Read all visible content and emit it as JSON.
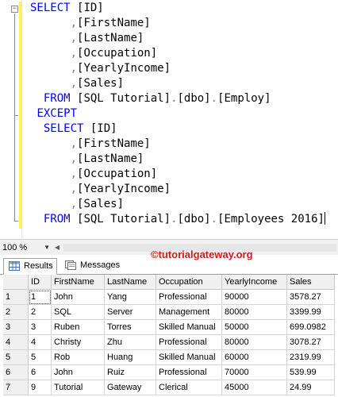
{
  "editor": {
    "lines": [
      {
        "indent": "",
        "segments": [
          {
            "c": "kw",
            "t": "SELECT"
          },
          {
            "c": "pun",
            "t": " "
          },
          {
            "c": "ident",
            "t": "[ID]"
          }
        ]
      },
      {
        "indent": "      ",
        "segments": [
          {
            "c": "pun",
            "t": ","
          },
          {
            "c": "ident",
            "t": "[FirstName]"
          }
        ]
      },
      {
        "indent": "      ",
        "segments": [
          {
            "c": "pun",
            "t": ","
          },
          {
            "c": "ident",
            "t": "[LastName]"
          }
        ]
      },
      {
        "indent": "      ",
        "segments": [
          {
            "c": "pun",
            "t": ","
          },
          {
            "c": "ident",
            "t": "[Occupation]"
          }
        ]
      },
      {
        "indent": "      ",
        "segments": [
          {
            "c": "pun",
            "t": ","
          },
          {
            "c": "ident",
            "t": "[YearlyIncome]"
          }
        ]
      },
      {
        "indent": "      ",
        "segments": [
          {
            "c": "pun",
            "t": ","
          },
          {
            "c": "ident",
            "t": "[Sales]"
          }
        ]
      },
      {
        "indent": "  ",
        "segments": [
          {
            "c": "kw",
            "t": "FROM"
          },
          {
            "c": "pun",
            "t": " "
          },
          {
            "c": "ident",
            "t": "[SQL Tutorial]"
          },
          {
            "c": "pun",
            "t": "."
          },
          {
            "c": "ident",
            "t": "[dbo]"
          },
          {
            "c": "pun",
            "t": "."
          },
          {
            "c": "ident",
            "t": "[Employ]"
          }
        ]
      },
      {
        "indent": " ",
        "segments": [
          {
            "c": "kw",
            "t": "EXCEPT"
          }
        ]
      },
      {
        "indent": "  ",
        "segments": [
          {
            "c": "kw",
            "t": "SELECT"
          },
          {
            "c": "pun",
            "t": " "
          },
          {
            "c": "ident",
            "t": "[ID]"
          }
        ]
      },
      {
        "indent": "      ",
        "segments": [
          {
            "c": "pun",
            "t": ","
          },
          {
            "c": "ident",
            "t": "[FirstName]"
          }
        ]
      },
      {
        "indent": "      ",
        "segments": [
          {
            "c": "pun",
            "t": ","
          },
          {
            "c": "ident",
            "t": "[LastName]"
          }
        ]
      },
      {
        "indent": "      ",
        "segments": [
          {
            "c": "pun",
            "t": ","
          },
          {
            "c": "ident",
            "t": "[Occupation]"
          }
        ]
      },
      {
        "indent": "      ",
        "segments": [
          {
            "c": "pun",
            "t": ","
          },
          {
            "c": "ident",
            "t": "[YearlyIncome]"
          }
        ]
      },
      {
        "indent": "      ",
        "segments": [
          {
            "c": "pun",
            "t": ","
          },
          {
            "c": "ident",
            "t": "[Sales]"
          }
        ]
      },
      {
        "indent": "  ",
        "segments": [
          {
            "c": "kw",
            "t": "FROM"
          },
          {
            "c": "pun",
            "t": " "
          },
          {
            "c": "ident",
            "t": "[SQL Tutorial]"
          },
          {
            "c": "pun",
            "t": "."
          },
          {
            "c": "ident",
            "t": "[dbo]"
          },
          {
            "c": "pun",
            "t": "."
          },
          {
            "c": "ident",
            "t": "[Employees 2016]"
          }
        ]
      }
    ]
  },
  "zoom": {
    "value": "100 %"
  },
  "tabs": {
    "results": "Results",
    "messages": "Messages"
  },
  "watermark": "©tutorialgateway.org",
  "colors": {
    "keyword": "#0000ff",
    "punctuation": "#808080",
    "watermark": "#c8201a",
    "change_marker": "#ffee62"
  },
  "grid": {
    "columns": [
      "",
      "ID",
      "FirstName",
      "LastName",
      "Occupation",
      "YearlyIncome",
      "Sales"
    ],
    "rows": [
      [
        "1",
        "1",
        "John",
        "Yang",
        "Professional",
        "90000",
        "3578.27"
      ],
      [
        "2",
        "2",
        "SQL",
        "Server",
        "Management",
        "80000",
        "3399.99"
      ],
      [
        "3",
        "3",
        "Ruben",
        "Torres",
        "Skilled Manual",
        "50000",
        "699.0982"
      ],
      [
        "4",
        "4",
        "Christy",
        "Zhu",
        "Professional",
        "80000",
        "3078.27"
      ],
      [
        "5",
        "5",
        "Rob",
        "Huang",
        "Skilled Manual",
        "60000",
        "2319.99"
      ],
      [
        "6",
        "6",
        "John",
        "Ruiz",
        "Professional",
        "70000",
        "539.99"
      ],
      [
        "7",
        "9",
        "Tutorial",
        "Gateway",
        "Clerical",
        "45000",
        "24.99"
      ]
    ]
  }
}
